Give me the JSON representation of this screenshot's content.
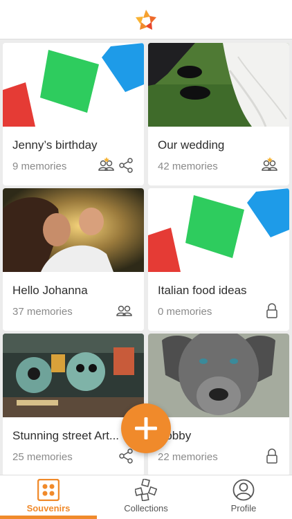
{
  "app": {
    "logo": "app-flower-logo",
    "accent_color": "#f08a2b"
  },
  "cards": [
    {
      "title": "Jenny’s birthday",
      "count": "9 memories",
      "icons": [
        "group-icon",
        "share-icon"
      ],
      "image": "colorful-shapes"
    },
    {
      "title": "Our wedding",
      "count": "42 memories",
      "icons": [
        "group-icon"
      ],
      "image": "wedding-shoes-dress"
    },
    {
      "title": "Hello Johanna",
      "count": "37 memories",
      "icons": [
        "group-icon"
      ],
      "image": "mother-and-baby"
    },
    {
      "title": "Italian food ideas",
      "count": "0 memories",
      "icons": [
        "lock-icon"
      ],
      "image": "colorful-shapes"
    },
    {
      "title": "Stunning street Art...",
      "count": "25 memories",
      "icons": [
        "share-icon"
      ],
      "image": "street-art-mural"
    },
    {
      "title": "Bobby",
      "count": "22 memories",
      "icons": [
        "lock-icon"
      ],
      "image": "grey-dog"
    }
  ],
  "fab": {
    "icon": "plus-icon"
  },
  "nav": {
    "tabs": [
      {
        "label": "Souvenirs",
        "icon": "souvenirs-icon",
        "active": true
      },
      {
        "label": "Collections",
        "icon": "collections-icon",
        "active": false
      },
      {
        "label": "Profile",
        "icon": "profile-icon",
        "active": false
      }
    ]
  }
}
